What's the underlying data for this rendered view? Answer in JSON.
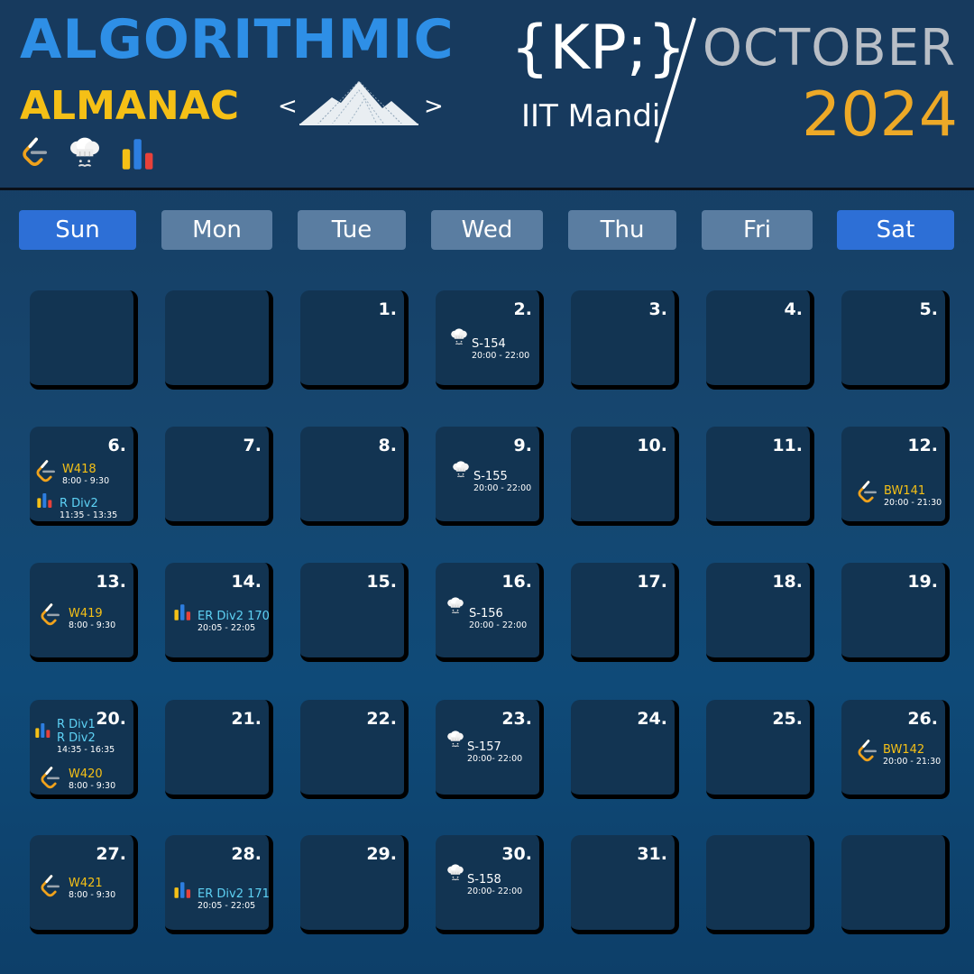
{
  "header": {
    "title_line1": "ALGORITHMIC",
    "title_line2": "ALMANAC",
    "nav_prev": "<",
    "nav_next": ">",
    "kp_logo": "{KP;}",
    "institute": "IIT Mandi",
    "month": "OCTOBER",
    "year": "2024",
    "icons": [
      "leetcode-icon",
      "codechef-chef-icon",
      "codeforces-bars-icon"
    ]
  },
  "weekdays": [
    "Sun",
    "Mon",
    "Tue",
    "Wed",
    "Thu",
    "Fri",
    "Sat"
  ],
  "days": {
    "d1": "1.",
    "d2": "2.",
    "d3": "3.",
    "d4": "4.",
    "d5": "5.",
    "d6": "6.",
    "d7": "7.",
    "d8": "8.",
    "d9": "9.",
    "d10": "10.",
    "d11": "11.",
    "d12": "12.",
    "d13": "13.",
    "d14": "14.",
    "d15": "15.",
    "d16": "16.",
    "d17": "17.",
    "d18": "18.",
    "d19": "19.",
    "d20": "20.",
    "d21": "21.",
    "d22": "22.",
    "d23": "23.",
    "d24": "24.",
    "d25": "25.",
    "d26": "26.",
    "d27": "27.",
    "d28": "28.",
    "d29": "29.",
    "d30": "30.",
    "d31": "31."
  },
  "events": {
    "e2": {
      "name": "S-154",
      "time": "20:00 - 22:00",
      "icon": "codechef-chef-icon"
    },
    "e6a": {
      "name": "W418",
      "time": "8:00 - 9:30",
      "icon": "leetcode-icon"
    },
    "e6b": {
      "name": "R Div2",
      "time": "11:35 - 13:35",
      "icon": "codeforces-bars-icon"
    },
    "e9": {
      "name": "S-155",
      "time": "20:00 - 22:00",
      "icon": "codechef-chef-icon"
    },
    "e12": {
      "name": "BW141",
      "time": "20:00 - 21:30",
      "icon": "leetcode-icon"
    },
    "e13": {
      "name": "W419",
      "time": "8:00 - 9:30",
      "icon": "leetcode-icon"
    },
    "e14": {
      "name": "ER Div2 170",
      "time": "20:05 - 22:05",
      "icon": "codeforces-bars-icon"
    },
    "e16": {
      "name": "S-156",
      "time": "20:00 - 22:00",
      "icon": "codechef-chef-icon"
    },
    "e20a": {
      "name1": "R Div1",
      "name2": "R Div2",
      "time": "14:35 - 16:35",
      "icon": "codeforces-bars-icon"
    },
    "e20b": {
      "name": "W420",
      "time": "8:00 - 9:30",
      "icon": "leetcode-icon"
    },
    "e23": {
      "name": "S-157",
      "time": "20:00- 22:00",
      "icon": "codechef-chef-icon"
    },
    "e26": {
      "name": "BW142",
      "time": "20:00 - 21:30",
      "icon": "leetcode-icon"
    },
    "e27": {
      "name": "W421",
      "time": "8:00 - 9:30",
      "icon": "leetcode-icon"
    },
    "e28": {
      "name": "ER Div2 171",
      "time": "20:05 - 22:05",
      "icon": "codeforces-bars-icon"
    },
    "e30": {
      "name": "S-158",
      "time": "20:00- 22:00",
      "icon": "codechef-chef-icon"
    }
  },
  "colors": {
    "title_blue": "#2e8fe6",
    "title_yellow": "#f5c016",
    "year_orange": "#eda927",
    "weekend_header": "#2d6fd6",
    "weekday_header": "#5a7da1",
    "codeforces_yellow": "#f5c016",
    "codeforces_blue": "#2d7ee0",
    "codeforces_red": "#e8413a"
  }
}
